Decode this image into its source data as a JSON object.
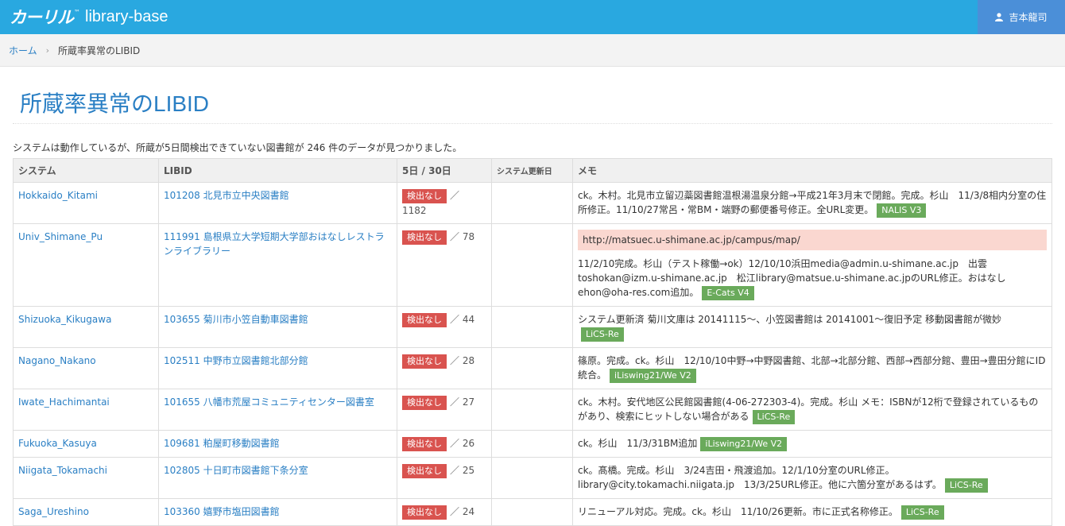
{
  "navbar": {
    "logo": "カーリル",
    "logo_tm": "™",
    "app_name": "library-base",
    "user_name": "吉本龍司"
  },
  "breadcrumb": {
    "home": "ホーム",
    "current": "所蔵率異常のLIBID"
  },
  "page": {
    "title": "所蔵率異常のLIBID",
    "summary": "システムは動作しているが、所蔵が5日間検出できていない図書館が 246 件のデータが見つかりました。"
  },
  "table": {
    "headers": [
      "システム",
      "LIBID",
      "5日 / 30日",
      "システム更新日",
      "メモ"
    ],
    "rows": [
      {
        "system": "Hokkaido_Kitami",
        "libid": "101208 北見市立中央図書館",
        "badge": "検出なし",
        "count": "／ 1182",
        "updated": "",
        "alert": "",
        "memo": "ck。木村。北見市立留辺蘂図書館温根湯温泉分館→平成21年3月末で閉館。完成。杉山　11/3/8相内分室の住所修正。11/10/27常呂・常BM・端野の郵便番号修正。全URL変更。",
        "tag": "NALIS V3"
      },
      {
        "system": "Univ_Shimane_Pu",
        "libid": "111991 島根県立大学短期大学部おはなしレストランライブラリー",
        "badge": "検出なし",
        "count": "／ 78",
        "updated": "",
        "alert": "http://matsuec.u-shimane.ac.jp/campus/map/",
        "memo": "11/2/10完成。杉山（テスト稼働→ok）12/10/10浜田media@admin.u-shimane.ac.jp　出雲toshokan@izm.u-shimane.ac.jp　松江library@matsue.u-shimane.ac.jpのURL修正。おはなしehon@oha-res.com追加。",
        "tag": "E-Cats V4"
      },
      {
        "system": "Shizuoka_Kikugawa",
        "libid": "103655 菊川市小笠自動車図書館",
        "badge": "検出なし",
        "count": "／ 44",
        "updated": "",
        "alert": "",
        "memo": "システム更新済 菊川文庫は 20141115〜、小笠図書館は 20141001〜復旧予定 移動図書館が微妙",
        "tag": "LiCS-Re"
      },
      {
        "system": "Nagano_Nakano",
        "libid": "102511 中野市立図書館北部分館",
        "badge": "検出なし",
        "count": "／ 28",
        "updated": "",
        "alert": "",
        "memo": "篠原。完成。ck。杉山　12/10/10中野→中野図書館、北部→北部分館、西部→西部分館、豊田→豊田分館にID統合。",
        "tag": "iLiswing21/We V2"
      },
      {
        "system": "Iwate_Hachimantai",
        "libid": "101655 八幡市荒屋コミュニティセンター図書室",
        "badge": "検出なし",
        "count": "／ 27",
        "updated": "",
        "alert": "",
        "memo": "ck。木村。安代地区公民館図書館(4-06-272303-4)。完成。杉山 メモ：ISBNが12桁で登録されているものがあり、検索にヒットしない場合がある",
        "tag": "LiCS-Re"
      },
      {
        "system": "Fukuoka_Kasuya",
        "libid": "109681 粕屋町移動図書館",
        "badge": "検出なし",
        "count": "／ 26",
        "updated": "",
        "alert": "",
        "memo": "ck。杉山　11/3/31BM追加",
        "tag": "iLiswing21/We V2"
      },
      {
        "system": "Niigata_Tokamachi",
        "libid": "102805 十日町市図書館下条分室",
        "badge": "検出なし",
        "count": "／ 25",
        "updated": "",
        "alert": "",
        "memo": "ck。髙橋。完成。杉山　3/24吉田・飛渡追加。12/1/10分室のURL修正。library@city.tokamachi.niigata.jp　13/3/25URL修正。他に六箇分室があるはず。",
        "tag": "LiCS-Re"
      },
      {
        "system": "Saga_Ureshino",
        "libid": "103360 嬉野市塩田図書館",
        "badge": "検出なし",
        "count": "／ 24",
        "updated": "",
        "alert": "",
        "memo": "リニューアル対応。完成。ck。杉山　11/10/26更新。市に正式名称修正。",
        "tag": "LiCS-Re"
      }
    ]
  },
  "colors": {
    "navbar": "#29a8e0",
    "user_box": "#4b8fd8",
    "link": "#2a7fc4",
    "badge": "#d9534f",
    "tag": "#6aaa5b",
    "alert": "#fad7d0"
  }
}
